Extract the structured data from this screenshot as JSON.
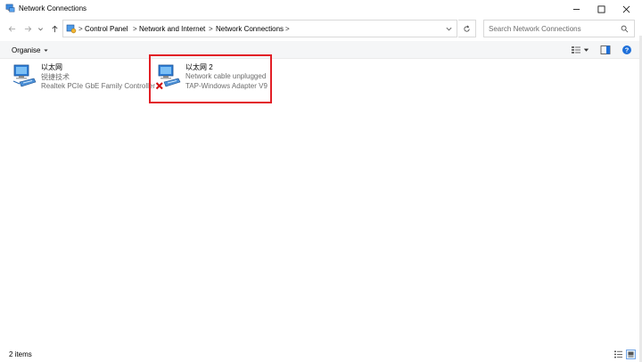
{
  "window": {
    "title": "Network Connections"
  },
  "titlebar": {
    "minimize_icon": "minimize-icon",
    "maximize_icon": "maximize-icon",
    "close_icon": "close-icon"
  },
  "breadcrumb": {
    "items": [
      "Control Panel",
      "Network and Internet",
      "Network Connections"
    ],
    "separator": ">"
  },
  "search": {
    "placeholder": "Search Network Connections"
  },
  "toolbar": {
    "organise_label": "Organise"
  },
  "connections": [
    {
      "name": "以太网",
      "status": "锐捷技术",
      "device": "Realtek PCIe GbE Family Controller",
      "disconnected": false
    },
    {
      "name": "以太网 2",
      "status": "Network cable unplugged",
      "device": "TAP-Windows Adapter V9",
      "disconnected": true
    }
  ],
  "statusbar": {
    "count": "2 items"
  },
  "colors": {
    "highlight": "#e21f26",
    "accent": "#1e6fd9",
    "error": "#d01010"
  }
}
